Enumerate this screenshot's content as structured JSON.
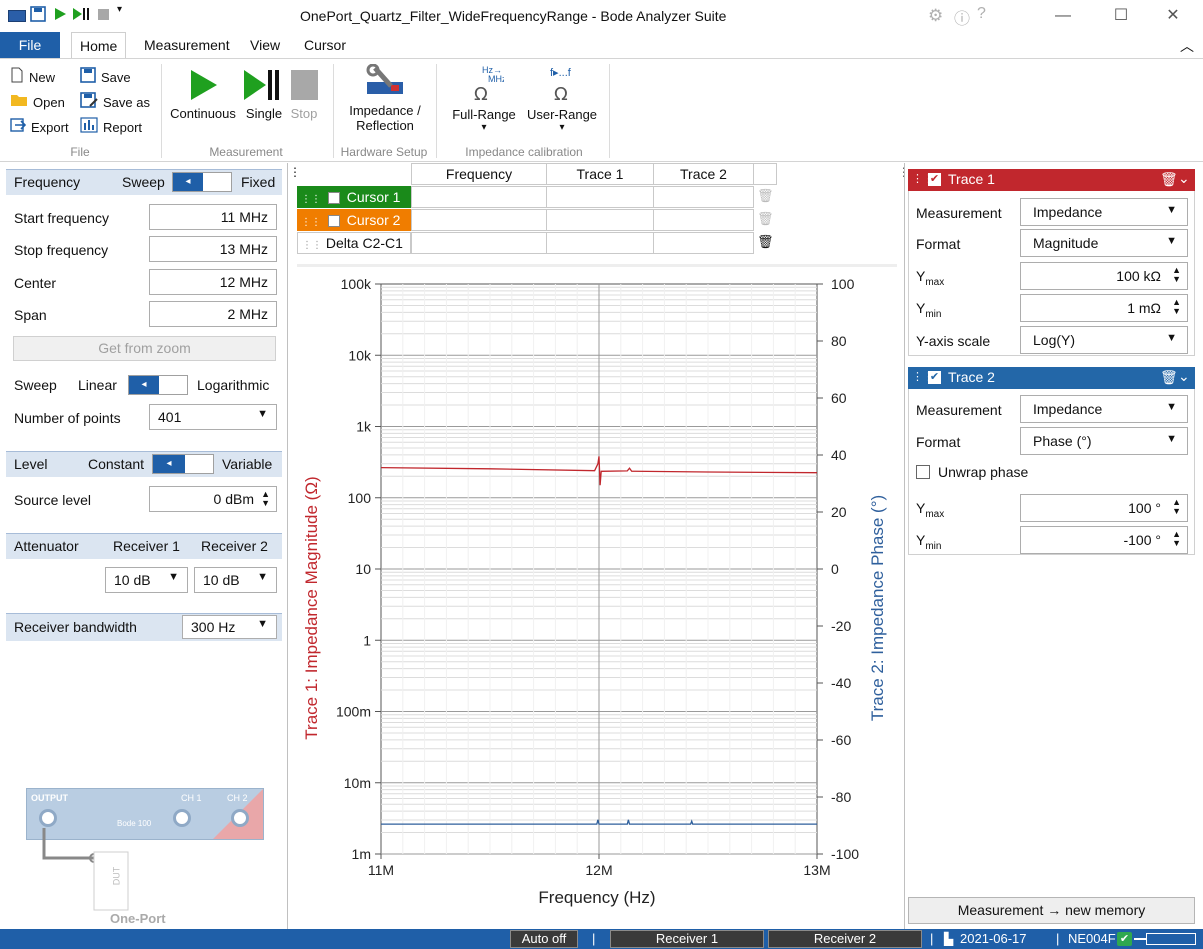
{
  "window": {
    "title": "OnePort_Quartz_Filter_WideFrequencyRange - Bode Analyzer Suite"
  },
  "menu": {
    "file": "File",
    "tabs": [
      "Home",
      "Measurement",
      "View",
      "Cursor"
    ]
  },
  "ribbon": {
    "file_group": {
      "new": "New",
      "open": "Open",
      "export": "Export",
      "save": "Save",
      "save_as": "Save as",
      "report": "Report",
      "label": "File"
    },
    "measurement_group": {
      "continuous": "Continuous",
      "single": "Single",
      "stop": "Stop",
      "label": "Measurement"
    },
    "hardware_group": {
      "impedance_line1": "Impedance /",
      "impedance_line2": "Reflection",
      "label": "Hardware Setup"
    },
    "calibration_group": {
      "full_range": "Full-Range",
      "user_range": "User-Range",
      "label": "Impedance calibration",
      "hz_mhz": "Hz →\nMHz",
      "f_range": "f...f"
    }
  },
  "left_panel": {
    "frequency": {
      "title": "Frequency",
      "sweep": "Sweep",
      "fixed": "Fixed"
    },
    "start_frequency": {
      "label": "Start frequency",
      "value": "11 MHz"
    },
    "stop_frequency": {
      "label": "Stop frequency",
      "value": "13 MHz"
    },
    "center": {
      "label": "Center",
      "value": "12 MHz"
    },
    "span": {
      "label": "Span",
      "value": "2 MHz"
    },
    "get_from_zoom": "Get from zoom",
    "sweep_mode": {
      "label": "Sweep",
      "linear": "Linear",
      "logarithmic": "Logarithmic"
    },
    "number_of_points": {
      "label": "Number of points",
      "value": "401"
    },
    "level": {
      "title": "Level",
      "constant": "Constant",
      "variable": "Variable"
    },
    "source_level": {
      "label": "Source level",
      "value": "0 dBm"
    },
    "attenuator": {
      "title": "Attenuator",
      "receiver1": "Receiver 1",
      "receiver2": "Receiver 2",
      "value1": "10 dB",
      "value2": "10 dB"
    },
    "receiver_bandwidth": {
      "label": "Receiver bandwidth",
      "value": "300 Hz"
    },
    "device": {
      "output": "OUTPUT",
      "ch1": "CH 1",
      "ch2": "CH 2",
      "model": "Bode 100",
      "dut": "DUT",
      "mode": "One-Port"
    }
  },
  "cursor_table": {
    "headers": [
      "Frequency",
      "Trace 1",
      "Trace 2"
    ],
    "rows": [
      {
        "name": "Cursor 1",
        "color": "#1a8a1a"
      },
      {
        "name": "Cursor 2",
        "color": "#f07d00"
      },
      {
        "name": "Delta C2-C1",
        "color": "#ffffff"
      }
    ]
  },
  "chart_data": {
    "type": "line",
    "xlabel": "Frequency (Hz)",
    "ylabel_left": "Trace 1: Impedance Magnitude (Ω)",
    "ylabel_right": "Trace 2: Impedance Phase (°)",
    "x_ticks": [
      "11M",
      "12M",
      "13M"
    ],
    "x_range_hz": [
      11000000,
      13000000
    ],
    "y_left_ticks": [
      "100k",
      "10k",
      "1k",
      "100",
      "10",
      "1",
      "100m",
      "10m",
      "1m"
    ],
    "y_left_range": [
      0.001,
      100000
    ],
    "y_left_scale": "log",
    "y_right_ticks": [
      "100",
      "80",
      "60",
      "40",
      "20",
      "0",
      "-20",
      "-40",
      "-60",
      "-80",
      "-100"
    ],
    "y_right_range": [
      -100,
      100
    ],
    "grid": true,
    "series": [
      {
        "name": "Trace 1",
        "color": "#c1272d",
        "axis": "left",
        "x_mhz": [
          11.0,
          11.5,
          11.98,
          11.995,
          12.0,
          12.005,
          12.01,
          12.13,
          12.14,
          12.15,
          12.5,
          13.0
        ],
        "values": [
          265,
          255,
          240,
          300,
          380,
          150,
          235,
          238,
          260,
          236,
          230,
          225
        ]
      },
      {
        "name": "Trace 2",
        "color": "#2e5f9c",
        "axis": "right",
        "x_mhz": [
          11.0,
          11.99,
          11.995,
          12.0,
          12.005,
          12.1,
          12.13,
          12.135,
          12.14,
          12.42,
          12.425,
          12.43,
          13.0
        ],
        "values": [
          -89.5,
          -89.5,
          -88,
          -89.5,
          -89.5,
          -89.5,
          -89.5,
          -88,
          -89.5,
          -89.5,
          -88.5,
          -89.5,
          -89.5
        ]
      }
    ]
  },
  "right_panel": {
    "trace1": {
      "title": "Trace 1",
      "measurement": {
        "label": "Measurement",
        "value": "Impedance"
      },
      "format": {
        "label": "Format",
        "value": "Magnitude"
      },
      "ymax": {
        "label": "Y",
        "sub": "max",
        "value": "100 kΩ"
      },
      "ymin": {
        "label": "Y",
        "sub": "min",
        "value": "1 mΩ"
      },
      "y_axis_scale": {
        "label": "Y-axis scale",
        "value": "Log(Y)"
      }
    },
    "trace2": {
      "title": "Trace 2",
      "measurement": {
        "label": "Measurement",
        "value": "Impedance"
      },
      "format": {
        "label": "Format",
        "value": "Phase (°)"
      },
      "unwrap": "Unwrap phase",
      "ymax": {
        "label": "Y",
        "sub": "max",
        "value": "100 °"
      },
      "ymin": {
        "label": "Y",
        "sub": "min",
        "value": "-100 °"
      }
    },
    "new_memory_button": "Measurement → new memory"
  },
  "status_bar": {
    "auto_off": "Auto off",
    "receiver1": "Receiver 1",
    "receiver2": "Receiver 2",
    "date": "2021-06-17",
    "device_id": "NE004F"
  },
  "colors": {
    "accent": "#1f5fa8",
    "trace1_header": "#c1272d",
    "trace2_header": "#2367a8",
    "section_bg": "#dbe5f1"
  }
}
